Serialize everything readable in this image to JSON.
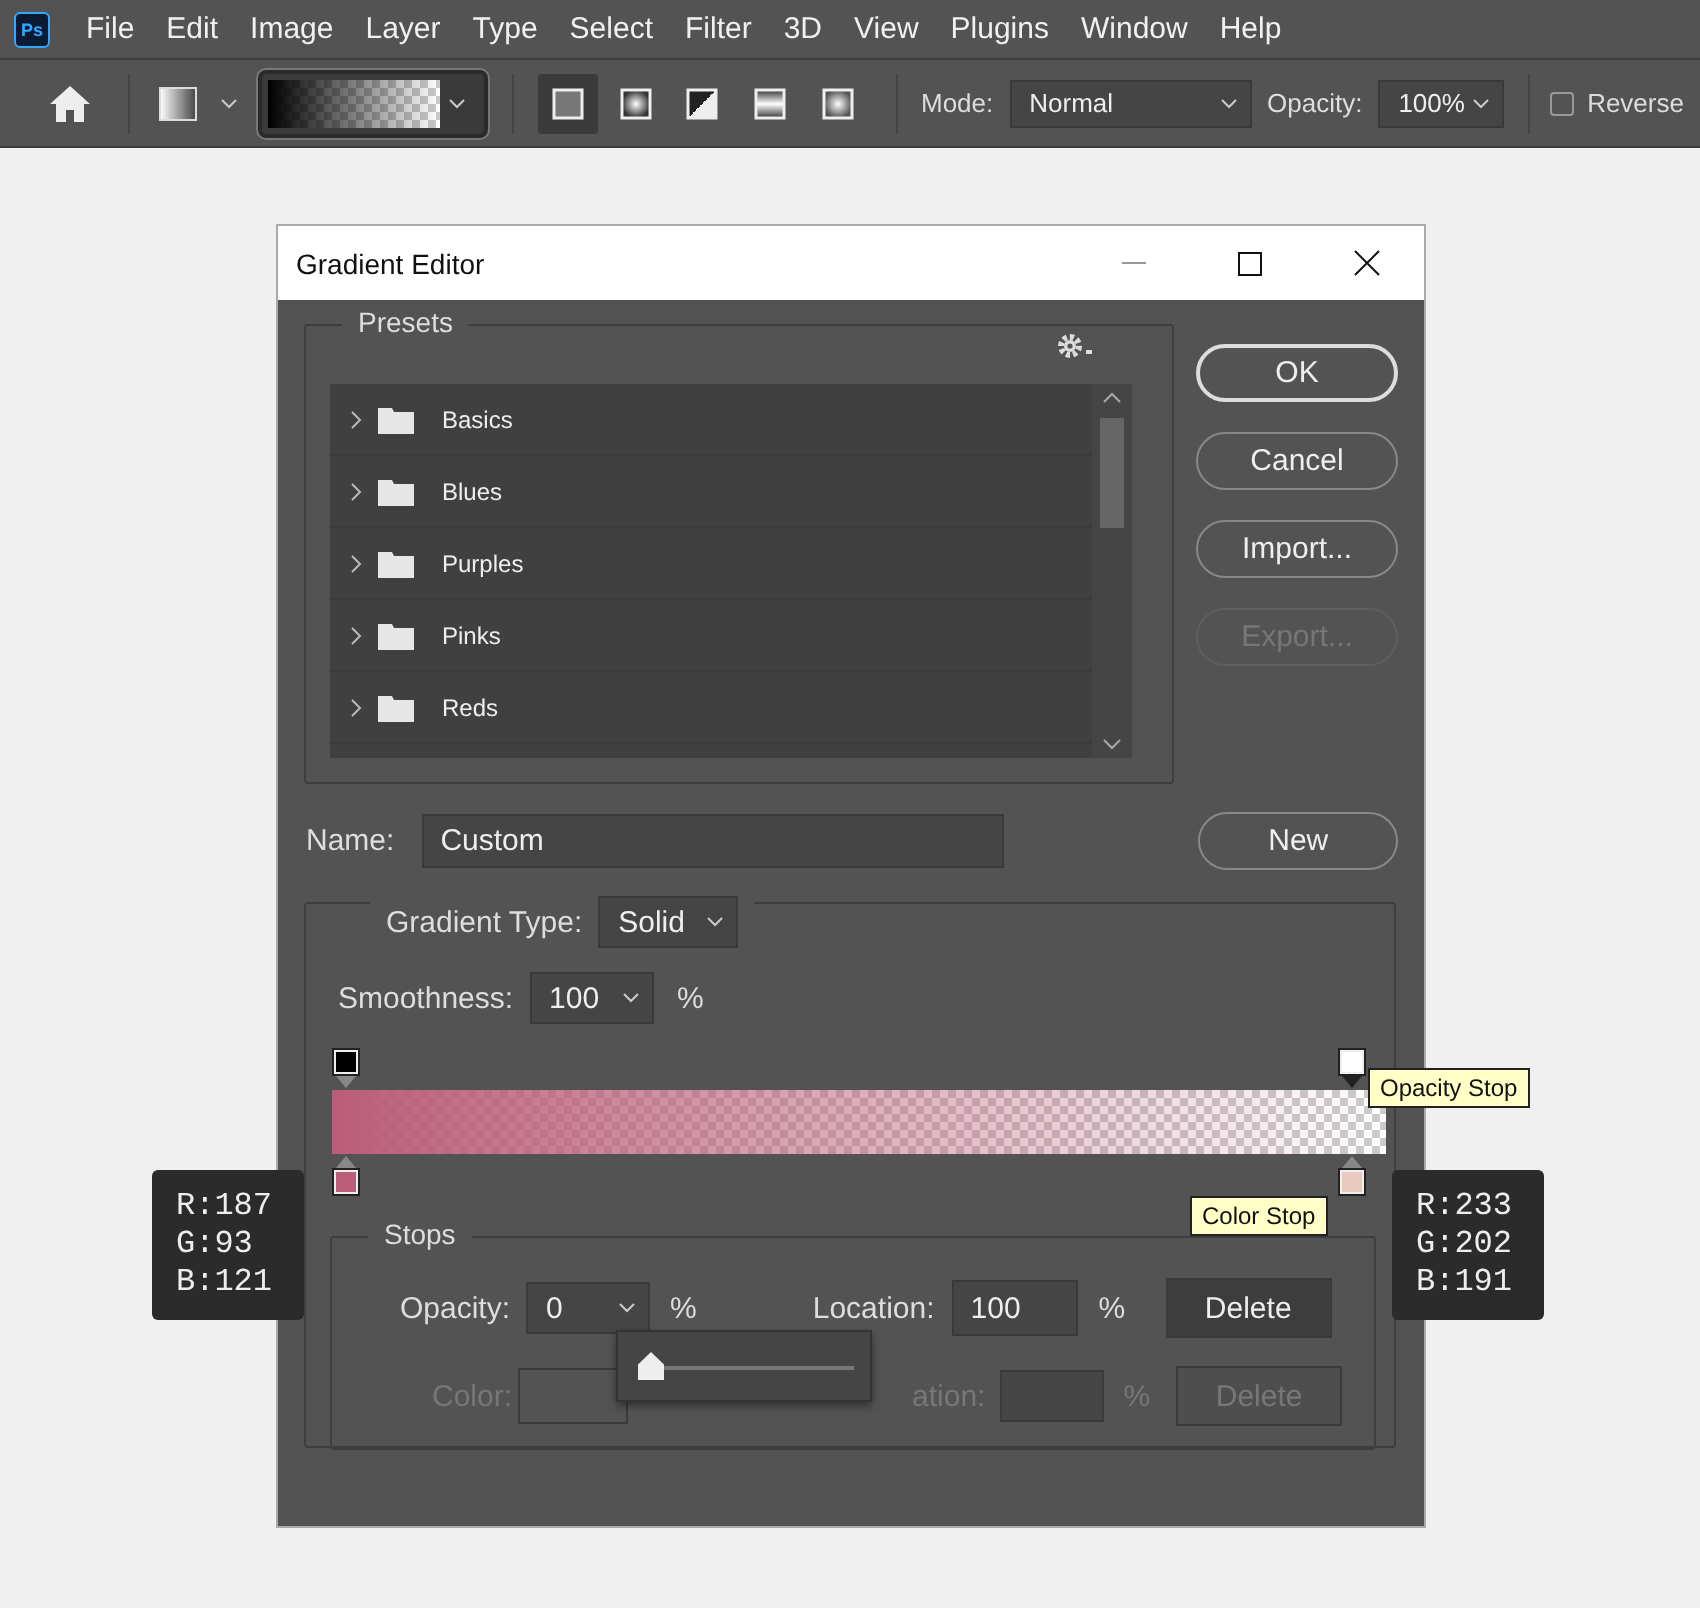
{
  "menu_bar": {
    "logo": "Ps",
    "items": [
      "File",
      "Edit",
      "Image",
      "Layer",
      "Type",
      "Select",
      "Filter",
      "3D",
      "View",
      "Plugins",
      "Window",
      "Help"
    ]
  },
  "toolbar": {
    "shapes": [
      {
        "selected": true
      },
      {
        "selected": false
      },
      {
        "selected": false
      },
      {
        "selected": false
      },
      {
        "selected": false
      }
    ],
    "mode": {
      "label": "Mode:",
      "value": "Normal"
    },
    "opacity": {
      "label": "Opacity:",
      "value": "100%"
    },
    "reverse": {
      "label": "Reverse",
      "checked": false
    }
  },
  "dialog": {
    "title": "Gradient Editor",
    "presets": {
      "title": "Presets",
      "items": [
        {
          "label": "Basics",
          "expanded": false
        },
        {
          "label": "Blues",
          "expanded": false
        },
        {
          "label": "Purples",
          "expanded": false
        },
        {
          "label": "Pinks",
          "expanded": false
        },
        {
          "label": "Reds",
          "expanded": false
        }
      ]
    },
    "buttons": [
      {
        "label": "OK",
        "disabled": false,
        "default": true
      },
      {
        "label": "Cancel",
        "disabled": false,
        "default": false
      },
      {
        "label": "Import...",
        "disabled": false,
        "default": false
      },
      {
        "label": "Export...",
        "disabled": true,
        "default": false
      }
    ],
    "name": {
      "label": "Name:",
      "value": "Custom"
    },
    "new_button": "New",
    "gradient_type": {
      "label": "Gradient Type:",
      "value": "Solid"
    },
    "smoothness": {
      "label": "Smoothness:",
      "value": "100",
      "unit": "%"
    },
    "opacity_stops": [
      {
        "color": "#000000",
        "selected": false
      },
      {
        "color": "#ffffff",
        "selected": true
      }
    ],
    "color_stops": [
      {
        "color": "#bb5d79",
        "selected": false
      },
      {
        "color": "#e9cabf",
        "selected": false
      }
    ],
    "opacity_tooltip": "Opacity Stop",
    "color_tooltip": "Color Stop",
    "readouts": [
      {
        "lines": [
          "R:187",
          "G:93",
          "B:121"
        ]
      },
      {
        "lines": [
          "R:233",
          "G:202",
          "B:191"
        ]
      }
    ],
    "stops": {
      "title": "Stops",
      "opacity_row": {
        "label": "Opacity:",
        "value": "0",
        "unit": "%",
        "location_label": "Location:",
        "location_value": "100",
        "location_unit": "%",
        "delete": "Delete",
        "disabled": false
      },
      "color_row": {
        "label": "Color:",
        "location_label": "ation:",
        "location_unit": "%",
        "delete": "Delete",
        "disabled": true
      },
      "slider": {
        "level": 0
      }
    }
  }
}
